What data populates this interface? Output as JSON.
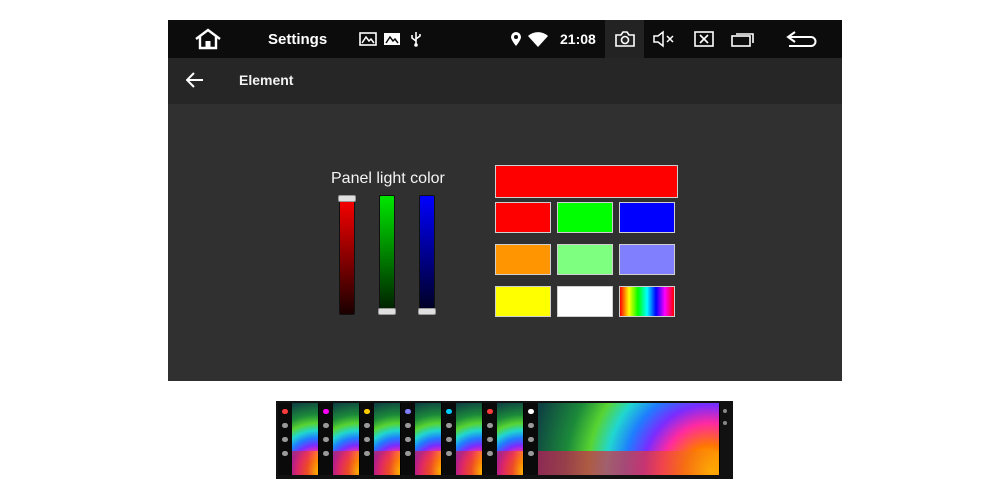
{
  "status_bar": {
    "app_name": "Settings",
    "time": "21:08",
    "icons": [
      "home-icon",
      "image-icon",
      "gallery-icon",
      "usb-icon",
      "location-icon",
      "wifi-icon",
      "camera-icon",
      "mute-icon",
      "close-app-icon",
      "recents-icon",
      "back-icon"
    ]
  },
  "header": {
    "title": "Element"
  },
  "panel": {
    "label": "Panel light color",
    "sliders": [
      {
        "channel": "red",
        "color": "#ff0000",
        "level": 1.0
      },
      {
        "channel": "green",
        "color": "#00e600",
        "level": 0.0
      },
      {
        "channel": "blue",
        "color": "#0000ff",
        "level": 0.0
      }
    ],
    "current_color": "#ff0000",
    "presets": [
      "#ff0000",
      "#00ff00",
      "#0000ff",
      "#ff9500",
      "#7fff7f",
      "#8080ff",
      "#ffff00",
      "#ffffff",
      "rainbow"
    ]
  }
}
